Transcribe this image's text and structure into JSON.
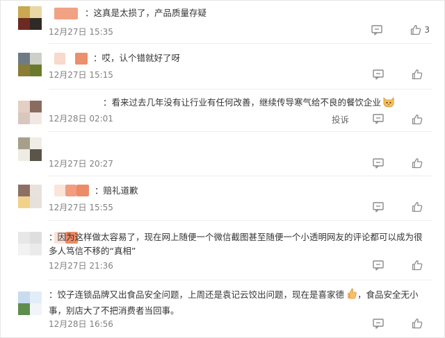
{
  "comments": [
    {
      "text": "：这真是太损了，产品质量存疑",
      "time": "12月27日 15:35",
      "likes": "3",
      "avatar": [
        "#c9a850",
        "#e9d7a4",
        "#6b2a22",
        "#2f2a26"
      ],
      "blur": [
        "#f0a283"
      ]
    },
    {
      "text": "：哎，认个错就好了呀",
      "time": "12月27日 15:15",
      "likes": "",
      "avatar": [
        "#6f7b84",
        "#cdd0c7",
        "#8a7d36",
        "#6b7a2b"
      ],
      "blur": [
        "#f8d9cb",
        "#ec8f6c"
      ]
    },
    {
      "text": "：看来过去几年没有让行业有任何改善，继续传导寒气给不良的餐饮企业",
      "time": "12月28日 02:01",
      "likes": "",
      "report": "投诉",
      "emoji": "cat-face-emoji",
      "avatar": [
        "#e3cfc4",
        "#8a6b5f",
        "#d8c7bd",
        "#f1e8e3"
      ],
      "blur": []
    },
    {
      "text": "",
      "time": "12月27日 20:27",
      "likes": "",
      "avatar": [
        "#a6a08a",
        "#efede6",
        "#eeece4",
        "#5a5548"
      ],
      "blur": []
    },
    {
      "text": "：赔礼道歉",
      "time": "12月27日 15:55",
      "likes": "",
      "avatar": [
        "#8d6f64",
        "#e9e2dc",
        "#f1d28b",
        "#e6e1da"
      ],
      "blur": [
        "#fbe4da",
        "#f19d80",
        "#ec8b68"
      ]
    },
    {
      "text": "：因为这样做太容易了，现在网上随便一个微信截图甚至随便一个小透明网友的评论都可以成为很多人笃信不移的“真相”",
      "time": "12月27日 21:36",
      "likes": "",
      "avatar": [
        "#e7e7e7",
        "#dedede",
        "#f2f2f2",
        "#eaeaea"
      ],
      "blur": [
        "#fae1d7",
        "#ee8a63"
      ]
    },
    {
      "text": "：饺子连锁品牌又出食品安全问题，上周还是袁记云饺出问题，现在是喜家德",
      "text2": "，食品安全无小事，别店大了不把消费者当回事。",
      "time": "12月28日 16:56",
      "likes": "",
      "emoji": "thumbs-up-emoji",
      "avatar": [
        "#c9dbef",
        "#e3edf8",
        "#5f8d4e",
        "#f1f4f8"
      ],
      "blur": []
    }
  ]
}
